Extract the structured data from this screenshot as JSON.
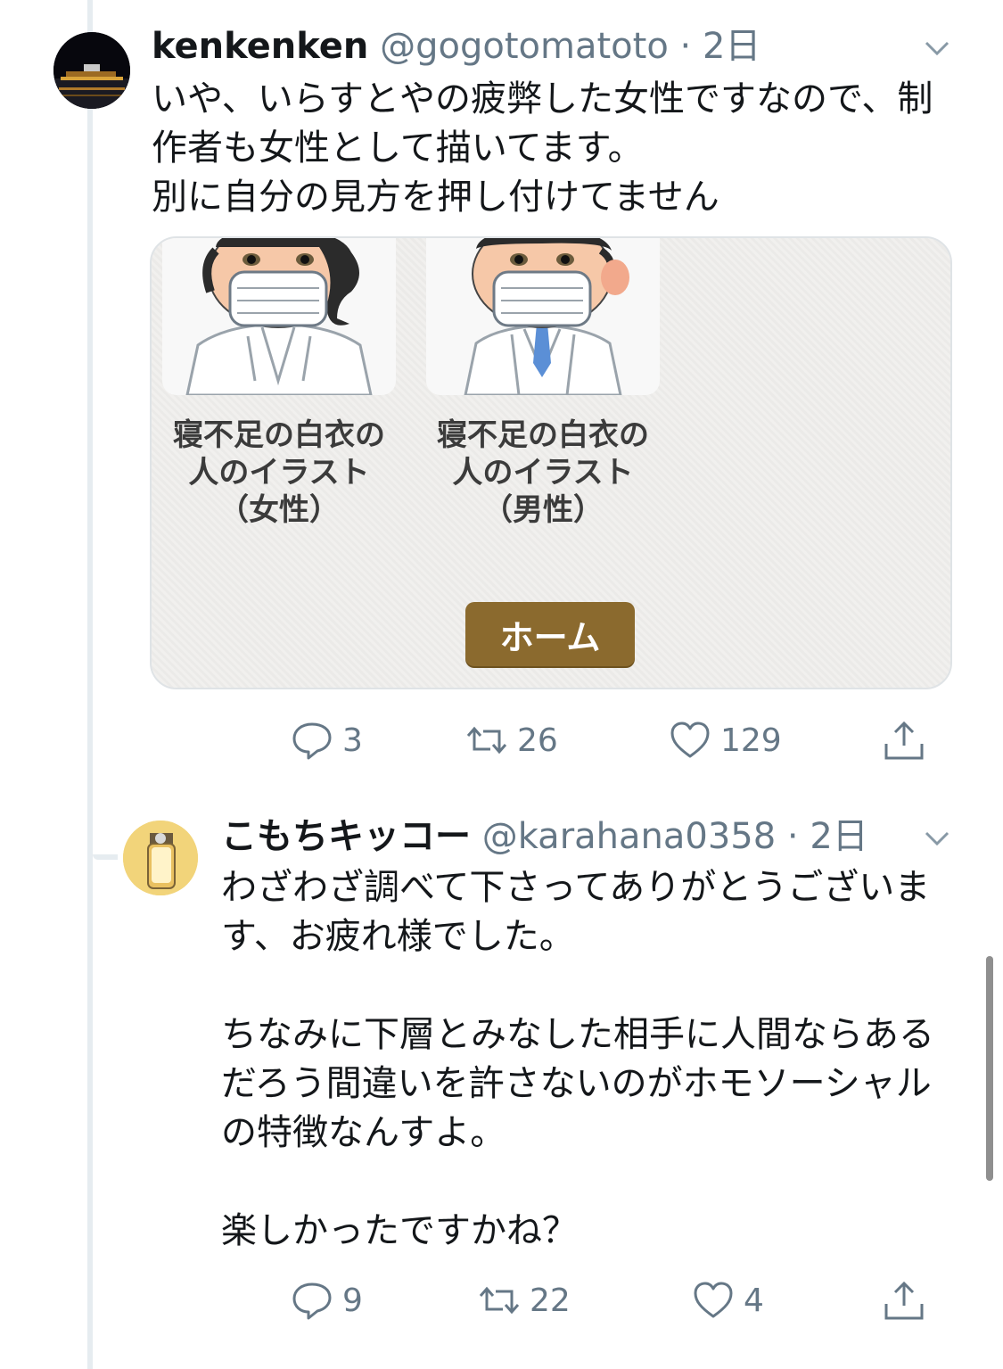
{
  "tweets": [
    {
      "name": "kenkenken",
      "handle": "@gogotomatoto",
      "time": "2日",
      "text": "いや、いらすとやの疲弊した女性ですなので、制\n作者も女性として描いてます。\n別に自分の見方を押し付けてません",
      "card": {
        "captions": [
          "寝不足の白衣の\n人のイラスト\n（女性）",
          "寝不足の白衣の\n人のイラスト\n（男性）"
        ],
        "button_label": "ホーム"
      },
      "actions": {
        "replies": "3",
        "retweets": "26",
        "likes": "129"
      }
    },
    {
      "name": "こもちキッコー",
      "handle": "@karahana0358",
      "time": "2日",
      "text": "わざわざ調べて下さってありがとうございま\nす、お疲れ様でした。\n\nちなみに下層とみなした相手に人間ならある\nだろう間違いを許さないのがホモソーシャル\nの特徴なんすよ。\n\n楽しかったですかね？",
      "actions": {
        "replies": "9",
        "retweets": "22",
        "likes": "4"
      }
    }
  ],
  "separator": "·",
  "colors": {
    "secondary_text": "#657786",
    "thread_line": "#e6ecf0",
    "home_button": "#8b6a2e"
  }
}
